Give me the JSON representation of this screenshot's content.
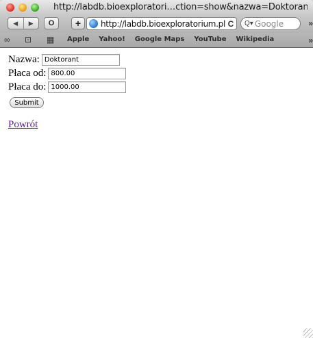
{
  "window": {
    "title": "http://labdb.bioexploratori…ction=show&nazwa=Doktorant"
  },
  "toolbar": {
    "back_glyph": "◀",
    "forward_glyph": "▶",
    "reader_glyph": "O",
    "add_glyph": "+",
    "url": "http://labdb.bioexploratorium.pl",
    "reload_glyph": "C",
    "search_placeholder": "Google",
    "search_glyph": "Q▾",
    "overflow_glyph": "»"
  },
  "bookmarks": {
    "items": [
      "Apple",
      "Yahoo!",
      "Google Maps",
      "YouTube",
      "Wikipedia"
    ],
    "reading_list_glyph": "∞",
    "book_glyph": "⊡",
    "grid_glyph": "▦",
    "overflow_glyph": "»"
  },
  "form": {
    "nazwa_label": "Nazwa:",
    "nazwa_value": "Doktorant",
    "placa_od_label": "Płaca od:",
    "placa_od_value": "800.00",
    "placa_do_label": "Płaca do:",
    "placa_do_value": "1000.00",
    "submit_label": "Submit"
  },
  "links": {
    "back_label": "Powrót"
  },
  "colors": {
    "link_visited": "#551a8b"
  }
}
